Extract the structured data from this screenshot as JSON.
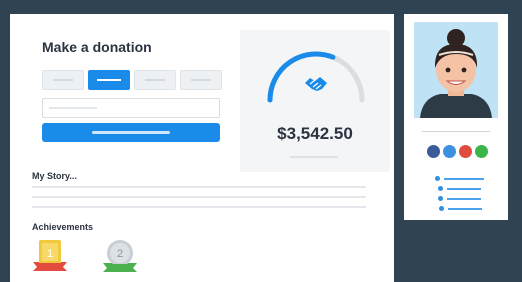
{
  "donation": {
    "title": "Make a donation",
    "total": "$3,542.50",
    "progress": 0.62
  },
  "story": {
    "title": "My Story..."
  },
  "achievements": {
    "title": "Achievements",
    "badges": [
      {
        "number": "1",
        "color": "#f3c83b"
      },
      {
        "number": "2",
        "color": "#c9ced4"
      }
    ]
  },
  "profile": {
    "social_dots": [
      "#3b5a9a",
      "#3d8fe0",
      "#e04b3f",
      "#39b54a"
    ]
  },
  "colors": {
    "accent": "#1a8be8",
    "background": "#2f4353",
    "gauge_track": "#d9dee3"
  }
}
